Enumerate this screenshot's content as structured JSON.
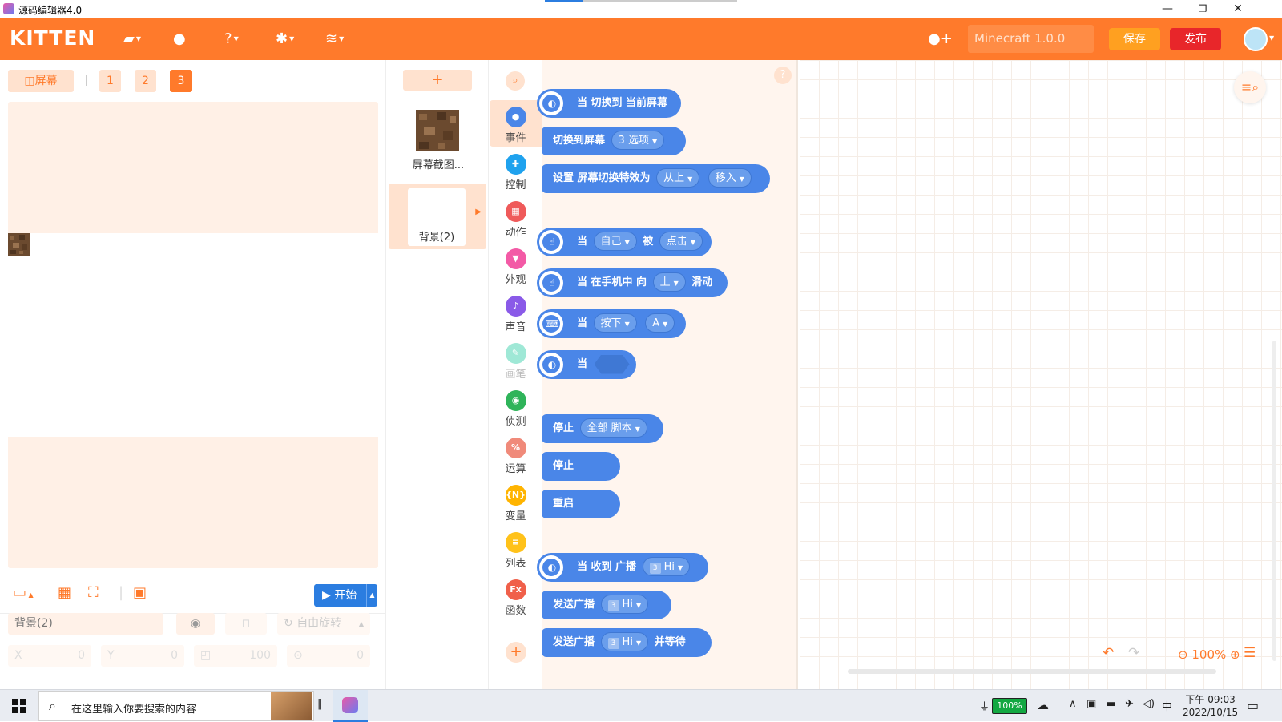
{
  "window": {
    "title": "源码编辑器4.0",
    "minimize": "—",
    "restore": "❐",
    "close": "✕"
  },
  "header": {
    "logo": "KITTEN",
    "project_name": "Minecraft 1.0.0",
    "save_label": "保存",
    "publish_label": "发布",
    "icons": [
      "folder-icon",
      "backpack-icon",
      "help-icon",
      "settings-icon",
      "wifi-icon",
      "add-user-icon",
      "avatar"
    ]
  },
  "stage": {
    "screen_label": "屏幕",
    "screens": [
      "1",
      "2",
      "3"
    ],
    "active_screen": "3",
    "start_label": "开始",
    "props": {
      "name": "背景(2)",
      "rotation_mode": "自由旋转",
      "x_label": "X",
      "x_value": "0",
      "y_label": "Y",
      "y_value": "0",
      "size_value": "100",
      "direction_value": "0"
    }
  },
  "sprites": {
    "add_label": "+",
    "items": [
      {
        "name": "屏幕截图..."
      },
      {
        "name": "背景(2)"
      }
    ]
  },
  "categories": [
    {
      "label": "事件",
      "color": "#4a86e8",
      "glyph": "●",
      "active": true
    },
    {
      "label": "控制",
      "color": "#1fa2ee",
      "glyph": "✚",
      "active": false
    },
    {
      "label": "动作",
      "color": "#ef5a5a",
      "glyph": "▦",
      "active": false
    },
    {
      "label": "外观",
      "color": "#f35aa6",
      "glyph": "▼",
      "active": false
    },
    {
      "label": "声音",
      "color": "#8a5ae8",
      "glyph": "♪",
      "active": false
    },
    {
      "label": "画笔",
      "color": "#9fe8d6",
      "glyph": "✎",
      "active": false
    },
    {
      "label": "侦测",
      "color": "#2fb45a",
      "glyph": "◉",
      "active": false
    },
    {
      "label": "运算",
      "color": "#f08a7a",
      "glyph": "%",
      "active": false
    },
    {
      "label": "变量",
      "color": "#ffb400",
      "glyph": "{N}",
      "active": false
    },
    {
      "label": "列表",
      "color": "#ffc21a",
      "glyph": "≡",
      "active": false
    },
    {
      "label": "函数",
      "color": "#f0604a",
      "glyph": "Fx",
      "active": false
    }
  ],
  "blocks": {
    "b1": {
      "text": "当 切换到 当前屏幕"
    },
    "b2": {
      "text": "切换到屏幕",
      "dd_num": "3",
      "dd": "选项"
    },
    "b3": {
      "text": "设置 屏幕切换特效为",
      "dd1": "从上",
      "dd2": "移入"
    },
    "b4": {
      "pre": "当",
      "dd1": "自己",
      "mid": "被",
      "dd2": "点击"
    },
    "b5": {
      "pre": "当 在手机中 向",
      "dd": "上",
      "post": "滑动"
    },
    "b6": {
      "pre": "当",
      "dd1": "按下",
      "dd2": "A"
    },
    "b7": {
      "pre": "当"
    },
    "b8": {
      "pre": "停止",
      "dd": "全部 脚本"
    },
    "b9": {
      "text": "停止"
    },
    "b10": {
      "text": "重启"
    },
    "b11": {
      "pre": "当 收到 广播",
      "dd_num": "3",
      "dd": "Hi"
    },
    "b12": {
      "pre": "发送广播",
      "dd_num": "3",
      "dd": "Hi"
    },
    "b13": {
      "pre": "发送广播",
      "dd_num": "3",
      "dd": "Hi",
      "post": "并等待"
    }
  },
  "workspace": {
    "zoom": "100%"
  },
  "taskbar": {
    "search_placeholder": "在这里输入你要搜索的内容",
    "battery": "100%",
    "ime": "中",
    "time": "下午 09:03",
    "date": "2022/10/15"
  }
}
